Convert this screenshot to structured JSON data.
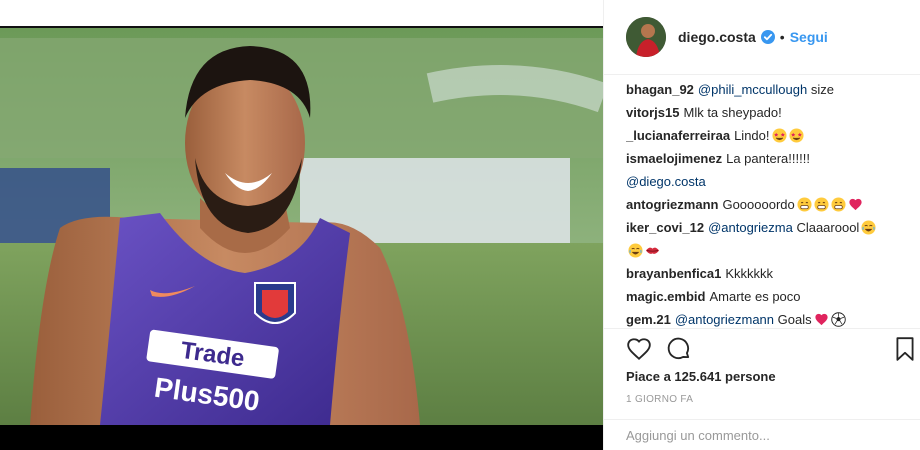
{
  "post": {
    "username": "diego.costa",
    "follow_label": "Segui",
    "separator": "•",
    "likes_text": "Piace a 125.641 persone",
    "time_text": "1 GIORNO FA",
    "add_comment_placeholder": "Aggiungi un commento...",
    "photo_jersey_text_line1": "Trade",
    "photo_jersey_text_line2": "Plus500"
  },
  "comments": [
    {
      "user": "bhagan_92",
      "mention": "@phili_mccullough",
      "text": " size",
      "emojis": []
    },
    {
      "user": "vitorjs15",
      "mention": "",
      "text": "Mlk ta sheypado!",
      "emojis": []
    },
    {
      "user": "_lucianaferreiraa",
      "mention": "",
      "text": "Lindo!",
      "emojis": [
        "star-eyes",
        "star-eyes"
      ]
    },
    {
      "user": "ismaelojimenez",
      "mention": "",
      "text": "La pantera!!!!!!",
      "emojis": []
    },
    {
      "user": "",
      "mention": "@diego.costa",
      "text": "",
      "emojis": []
    },
    {
      "user": "antogriezmann",
      "mention": "",
      "text": "Goooooordo",
      "emojis": [
        "grin",
        "grin",
        "grin",
        "heart"
      ]
    },
    {
      "user": "iker_covi_12",
      "mention": "@antogriezma",
      "text": " Claaaroool",
      "emojis": [
        "laugh"
      ]
    },
    {
      "user": "",
      "mention": "",
      "text": "",
      "emojis": [
        "laugh",
        "lips"
      ]
    },
    {
      "user": "brayanbenfica1",
      "mention": "",
      "text": "Kkkkkkk",
      "emojis": []
    },
    {
      "user": "magic.embid",
      "mention": "",
      "text": "Amarte es poco",
      "emojis": []
    },
    {
      "user": "gem.21",
      "mention": "@antogriezmann",
      "text": " Goals",
      "emojis": [
        "heart",
        "soccer"
      ]
    }
  ],
  "colors": {
    "link": "#3897f0",
    "mention": "#003569",
    "jersey": "#5a3fb0"
  }
}
